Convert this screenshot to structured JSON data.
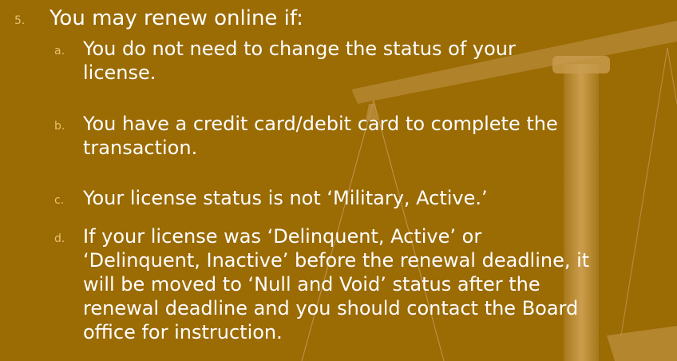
{
  "colors": {
    "background": "#9b6b04",
    "text": "#ffffff",
    "marker": "#e8c26c",
    "scale_light": "#c89a4b"
  },
  "decorative_icon": "scales-of-justice-watermark",
  "list": {
    "main": {
      "marker": "5.",
      "text": "You may renew online if:"
    },
    "items": [
      {
        "marker": "a.",
        "lines": [
          "You do not need to change the status of your",
          "license."
        ]
      },
      {
        "marker": "b.",
        "lines": [
          "You have a credit card/debit card to complete the",
          "transaction."
        ]
      },
      {
        "marker": "c.",
        "lines": [
          "Your license status is not ‘Military, Active.’"
        ]
      },
      {
        "marker": "d.",
        "lines": [
          "If your license was ‘Delinquent, Active’ or",
          "‘Delinquent, Inactive’ before the renewal deadline, it",
          "will be moved to ‘Null and Void’ status after the",
          "renewal deadline and you should contact the Board",
          "office for instruction."
        ]
      }
    ]
  }
}
